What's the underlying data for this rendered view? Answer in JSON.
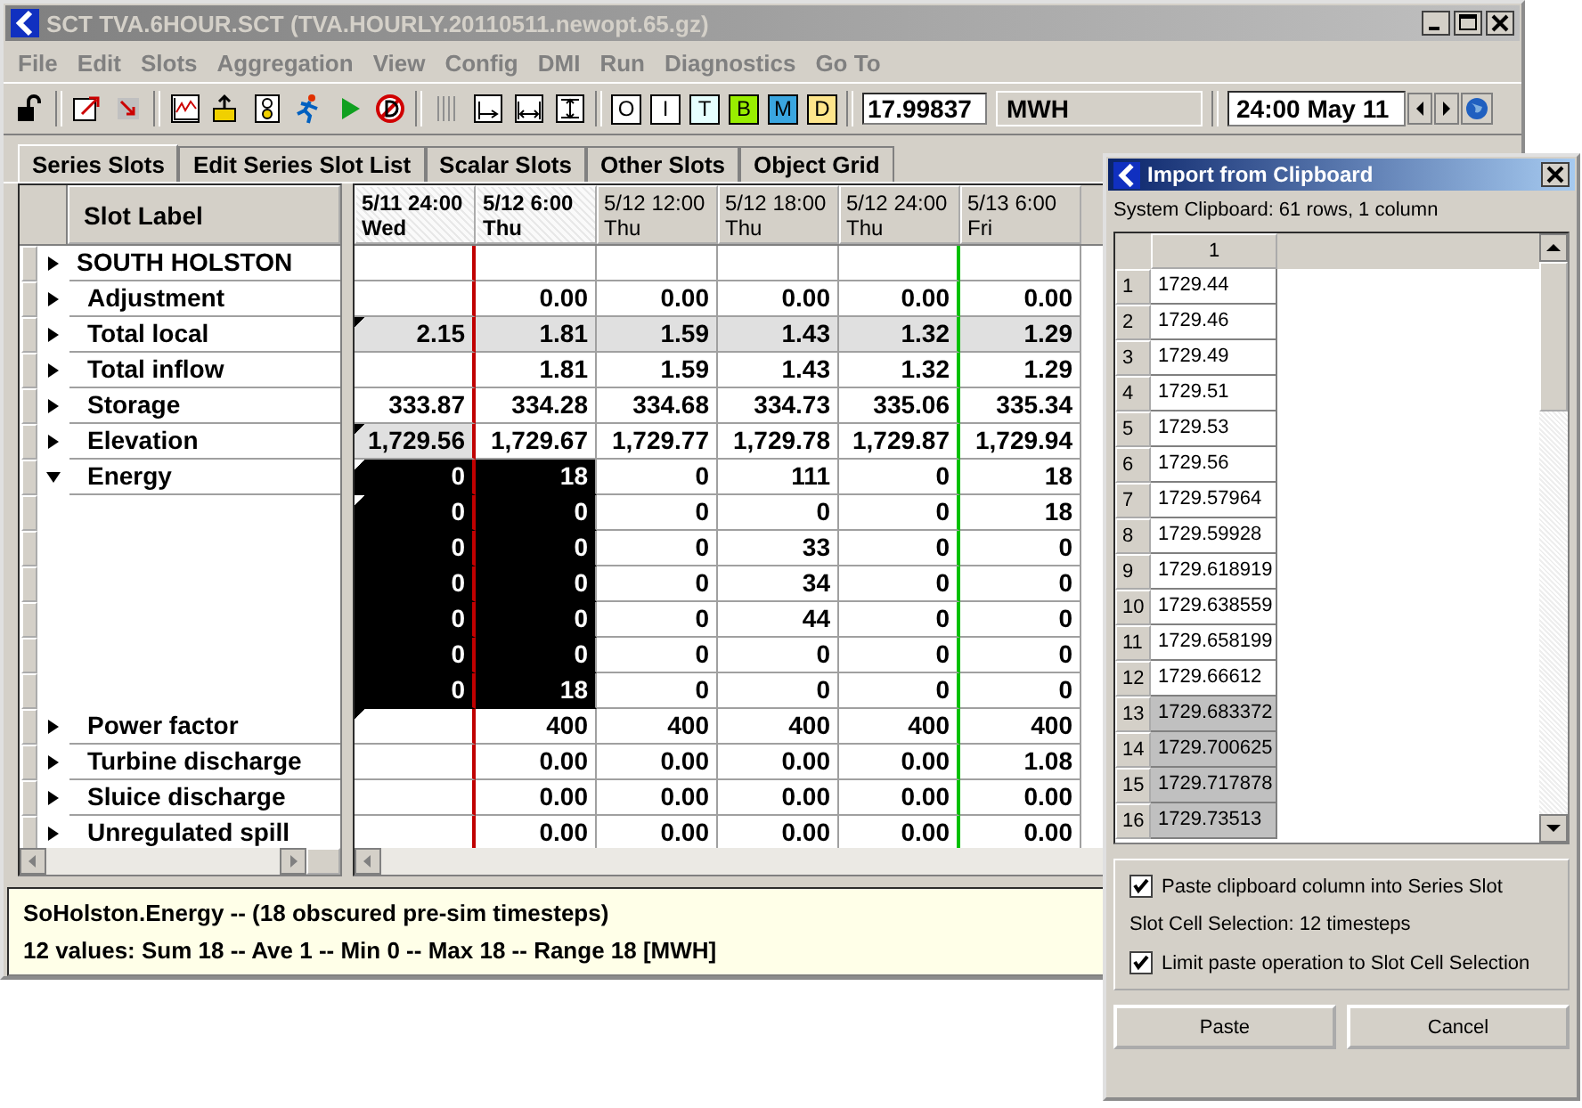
{
  "window": {
    "title": "SCT TVA.6HOUR.SCT (TVA.HOURLY.20110511.newopt.65.gz)"
  },
  "menu": [
    "File",
    "Edit",
    "Slots",
    "Aggregation",
    "View",
    "Config",
    "DMI",
    "Run",
    "Diagnostics",
    "Go To"
  ],
  "toolbar": {
    "letter_buttons": [
      {
        "label": "O",
        "color": "#ffffff"
      },
      {
        "label": "I",
        "color": "#ffffff"
      },
      {
        "label": "T",
        "color": "#e6ffff"
      },
      {
        "label": "B",
        "color": "#99ee00"
      },
      {
        "label": "M",
        "color": "#3aa6e0"
      },
      {
        "label": "D",
        "color": "#ffe68c"
      }
    ],
    "value_field": {
      "value": "17.99837"
    },
    "unit": "MWH",
    "date_field": {
      "value": "24:00 May 11"
    }
  },
  "tabs": [
    {
      "label": "Series Slots",
      "selected": true
    },
    {
      "label": "Edit Series Slot List",
      "selected": false
    },
    {
      "label": "Scalar Slots",
      "selected": false
    },
    {
      "label": "Other Slots",
      "selected": false
    },
    {
      "label": "Object Grid",
      "selected": false
    }
  ],
  "grid": {
    "label_header": "Slot Label",
    "columns": [
      {
        "date": "5/11 24:00",
        "day": "Wed",
        "selected": true,
        "start_line": true,
        "end_line": false
      },
      {
        "date": "5/12 6:00",
        "day": "Thu",
        "selected": true,
        "start_line": false,
        "end_line": false
      },
      {
        "date": "5/12 12:00",
        "day": "Thu",
        "selected": false,
        "start_line": false,
        "end_line": false
      },
      {
        "date": "5/12 18:00",
        "day": "Thu",
        "selected": false,
        "start_line": false,
        "end_line": false
      },
      {
        "date": "5/12 24:00",
        "day": "Thu",
        "selected": false,
        "start_line": false,
        "end_line": true
      },
      {
        "date": "5/13 6:00",
        "day": "Fri",
        "selected": false,
        "start_line": false,
        "end_line": false
      }
    ],
    "rows": [
      {
        "kind": "object",
        "label": "SOUTH HOLSTON",
        "expanded": false,
        "flagged": false,
        "cells": [
          {
            "shaded": false,
            "selected": false
          },
          {
            "shaded": false,
            "selected": false
          },
          {
            "shaded": false,
            "selected": false
          },
          {
            "shaded": false,
            "selected": false
          },
          {
            "shaded": false,
            "selected": false
          },
          {
            "shaded": false,
            "selected": false
          }
        ]
      },
      {
        "kind": "slot",
        "label": "Adjustment",
        "expanded": false,
        "flagged": false,
        "cells": [
          {
            "shaded": false,
            "selected": false
          },
          {
            "value": "0.00",
            "shaded": false,
            "selected": false
          },
          {
            "value": "0.00",
            "shaded": false,
            "selected": false
          },
          {
            "value": "0.00",
            "shaded": false,
            "selected": false
          },
          {
            "value": "0.00",
            "shaded": false,
            "selected": false
          },
          {
            "value": "0.00",
            "shaded": false,
            "selected": false
          }
        ]
      },
      {
        "kind": "slot",
        "label": "Total local",
        "expanded": false,
        "flagged": true,
        "cells": [
          {
            "value": "2.15",
            "shaded": true,
            "selected": false
          },
          {
            "value": "1.81",
            "shaded": true,
            "selected": false
          },
          {
            "value": "1.59",
            "shaded": true,
            "selected": false
          },
          {
            "value": "1.43",
            "shaded": true,
            "selected": false
          },
          {
            "value": "1.32",
            "shaded": true,
            "selected": false
          },
          {
            "value": "1.29",
            "shaded": true,
            "selected": false
          }
        ]
      },
      {
        "kind": "slot",
        "label": "Total inflow",
        "expanded": false,
        "flagged": false,
        "cells": [
          {
            "shaded": false,
            "selected": false
          },
          {
            "value": "1.81",
            "shaded": false,
            "selected": false
          },
          {
            "value": "1.59",
            "shaded": false,
            "selected": false
          },
          {
            "value": "1.43",
            "shaded": false,
            "selected": false
          },
          {
            "value": "1.32",
            "shaded": false,
            "selected": false
          },
          {
            "value": "1.29",
            "shaded": false,
            "selected": false
          }
        ]
      },
      {
        "kind": "slot",
        "label": "Storage",
        "expanded": false,
        "flagged": false,
        "cells": [
          {
            "value": "333.87",
            "shaded": false,
            "selected": false
          },
          {
            "value": "334.28",
            "shaded": false,
            "selected": false
          },
          {
            "value": "334.68",
            "shaded": false,
            "selected": false
          },
          {
            "value": "334.73",
            "shaded": false,
            "selected": false
          },
          {
            "value": "335.06",
            "shaded": false,
            "selected": false
          },
          {
            "value": "335.34",
            "shaded": false,
            "selected": false
          }
        ]
      },
      {
        "kind": "slot",
        "label": "Elevation",
        "expanded": false,
        "flagged": true,
        "cells": [
          {
            "value": "1,729.56",
            "shaded": true,
            "selected": false
          },
          {
            "value": "1,729.67",
            "shaded": false,
            "selected": false
          },
          {
            "value": "1,729.77",
            "shaded": false,
            "selected": false
          },
          {
            "value": "1,729.78",
            "shaded": false,
            "selected": false
          },
          {
            "value": "1,729.87",
            "shaded": false,
            "selected": false
          },
          {
            "value": "1,729.94",
            "shaded": false,
            "selected": false
          }
        ]
      },
      {
        "kind": "slot",
        "label": "Energy",
        "expanded": true,
        "flagged": true,
        "cells": [
          {
            "value": "0",
            "shaded": false,
            "selected": true
          },
          {
            "value": "18",
            "shaded": false,
            "selected": true
          },
          {
            "value": "0",
            "shaded": false,
            "selected": false
          },
          {
            "value": "111",
            "shaded": false,
            "selected": false
          },
          {
            "value": "0",
            "shaded": false,
            "selected": false
          },
          {
            "value": "18",
            "shaded": false,
            "selected": false
          }
        ]
      },
      {
        "kind": "subrow",
        "flagged": true,
        "cells": [
          {
            "value": "0",
            "shaded": false,
            "selected": true
          },
          {
            "value": "0",
            "shaded": false,
            "selected": true
          },
          {
            "value": "0",
            "shaded": false,
            "selected": false
          },
          {
            "value": "0",
            "shaded": false,
            "selected": false
          },
          {
            "value": "0",
            "shaded": false,
            "selected": false
          },
          {
            "value": "18",
            "shaded": false,
            "selected": false
          }
        ]
      },
      {
        "kind": "subrow",
        "flagged": false,
        "cells": [
          {
            "value": "0",
            "shaded": false,
            "selected": true
          },
          {
            "value": "0",
            "shaded": false,
            "selected": true
          },
          {
            "value": "0",
            "shaded": false,
            "selected": false
          },
          {
            "value": "33",
            "shaded": false,
            "selected": false
          },
          {
            "value": "0",
            "shaded": false,
            "selected": false
          },
          {
            "value": "0",
            "shaded": false,
            "selected": false
          }
        ]
      },
      {
        "kind": "subrow",
        "flagged": false,
        "cells": [
          {
            "value": "0",
            "shaded": false,
            "selected": true
          },
          {
            "value": "0",
            "shaded": false,
            "selected": true
          },
          {
            "value": "0",
            "shaded": false,
            "selected": false
          },
          {
            "value": "34",
            "shaded": false,
            "selected": false
          },
          {
            "value": "0",
            "shaded": false,
            "selected": false
          },
          {
            "value": "0",
            "shaded": false,
            "selected": false
          }
        ]
      },
      {
        "kind": "subrow",
        "flagged": false,
        "cells": [
          {
            "value": "0",
            "shaded": false,
            "selected": true
          },
          {
            "value": "0",
            "shaded": false,
            "selected": true
          },
          {
            "value": "0",
            "shaded": false,
            "selected": false
          },
          {
            "value": "44",
            "shaded": false,
            "selected": false
          },
          {
            "value": "0",
            "shaded": false,
            "selected": false
          },
          {
            "value": "0",
            "shaded": false,
            "selected": false
          }
        ]
      },
      {
        "kind": "subrow",
        "flagged": false,
        "cells": [
          {
            "value": "0",
            "shaded": false,
            "selected": true
          },
          {
            "value": "0",
            "shaded": false,
            "selected": true
          },
          {
            "value": "0",
            "shaded": false,
            "selected": false
          },
          {
            "value": "0",
            "shaded": false,
            "selected": false
          },
          {
            "value": "0",
            "shaded": false,
            "selected": false
          },
          {
            "value": "0",
            "shaded": false,
            "selected": false
          }
        ]
      },
      {
        "kind": "subrow",
        "flagged": false,
        "cells": [
          {
            "value": "0",
            "shaded": false,
            "selected": true
          },
          {
            "value": "18",
            "shaded": false,
            "selected": true
          },
          {
            "value": "0",
            "shaded": false,
            "selected": false
          },
          {
            "value": "0",
            "shaded": false,
            "selected": false
          },
          {
            "value": "0",
            "shaded": false,
            "selected": false
          },
          {
            "value": "0",
            "shaded": false,
            "selected": false
          }
        ]
      },
      {
        "kind": "slot",
        "label": "Power  factor",
        "expanded": false,
        "flagged": true,
        "cells": [
          {
            "shaded": false,
            "selected": false
          },
          {
            "value": "400",
            "shaded": false,
            "selected": false
          },
          {
            "value": "400",
            "shaded": false,
            "selected": false
          },
          {
            "value": "400",
            "shaded": false,
            "selected": false
          },
          {
            "value": "400",
            "shaded": false,
            "selected": false
          },
          {
            "value": "400",
            "shaded": false,
            "selected": false
          }
        ]
      },
      {
        "kind": "slot",
        "label": "Turbine discharge",
        "expanded": false,
        "flagged": false,
        "cells": [
          {
            "shaded": false,
            "selected": false
          },
          {
            "value": "0.00",
            "shaded": false,
            "selected": false
          },
          {
            "value": "0.00",
            "shaded": false,
            "selected": false
          },
          {
            "value": "0.00",
            "shaded": false,
            "selected": false
          },
          {
            "value": "0.00",
            "shaded": false,
            "selected": false
          },
          {
            "value": "1.08",
            "shaded": false,
            "selected": false
          }
        ]
      },
      {
        "kind": "slot",
        "label": "Sluice discharge",
        "expanded": false,
        "flagged": false,
        "cells": [
          {
            "shaded": false,
            "selected": false
          },
          {
            "value": "0.00",
            "shaded": false,
            "selected": false
          },
          {
            "value": "0.00",
            "shaded": false,
            "selected": false
          },
          {
            "value": "0.00",
            "shaded": false,
            "selected": false
          },
          {
            "value": "0.00",
            "shaded": false,
            "selected": false
          },
          {
            "value": "0.00",
            "shaded": false,
            "selected": false
          }
        ]
      },
      {
        "kind": "slot",
        "label": "Unregulated spill",
        "expanded": false,
        "flagged": false,
        "cells": [
          {
            "shaded": false,
            "selected": false
          },
          {
            "value": "0.00",
            "shaded": false,
            "selected": false
          },
          {
            "value": "0.00",
            "shaded": false,
            "selected": false
          },
          {
            "value": "0.00",
            "shaded": false,
            "selected": false
          },
          {
            "value": "0.00",
            "shaded": false,
            "selected": false
          },
          {
            "value": "0.00",
            "shaded": false,
            "selected": false
          }
        ]
      }
    ]
  },
  "status": {
    "lines": [
      "SoHolston.Energy -- (18 obscured pre-sim timesteps)",
      "12 values:  Sum 18 -- Ave 1 -- Min 0 -- Max 18 -- Range 18 [MWH]"
    ]
  },
  "dialog": {
    "title": "Import from Clipboard",
    "summary": "System Clipboard:  61 rows, 1 column",
    "column_header": "1",
    "rows": [
      {
        "number": "1",
        "value": "1729.44",
        "dimmed": false
      },
      {
        "number": "2",
        "value": "1729.46",
        "dimmed": false
      },
      {
        "number": "3",
        "value": "1729.49",
        "dimmed": false
      },
      {
        "number": "4",
        "value": "1729.51",
        "dimmed": false
      },
      {
        "number": "5",
        "value": "1729.53",
        "dimmed": false
      },
      {
        "number": "6",
        "value": "1729.56",
        "dimmed": false
      },
      {
        "number": "7",
        "value": "1729.57964",
        "dimmed": false
      },
      {
        "number": "8",
        "value": "1729.59928",
        "dimmed": false
      },
      {
        "number": "9",
        "value": "1729.618919",
        "dimmed": false
      },
      {
        "number": "10",
        "value": "1729.638559",
        "dimmed": false
      },
      {
        "number": "11",
        "value": "1729.658199",
        "dimmed": false
      },
      {
        "number": "12",
        "value": "1729.66612",
        "dimmed": false
      },
      {
        "number": "13",
        "value": "1729.683372",
        "dimmed": true
      },
      {
        "number": "14",
        "value": "1729.700625",
        "dimmed": true
      },
      {
        "number": "15",
        "value": "1729.717878",
        "dimmed": true
      },
      {
        "number": "16",
        "value": "1729.73513",
        "dimmed": true
      }
    ],
    "paste_into_slot": {
      "label": "Paste clipboard column into Series Slot",
      "checked": true
    },
    "selection_info": "Slot Cell Selection:  12 timesteps",
    "limit_to_selection": {
      "label": "Limit paste operation to Slot Cell Selection",
      "checked": true
    },
    "buttons": [
      "Paste",
      "Cancel"
    ]
  }
}
